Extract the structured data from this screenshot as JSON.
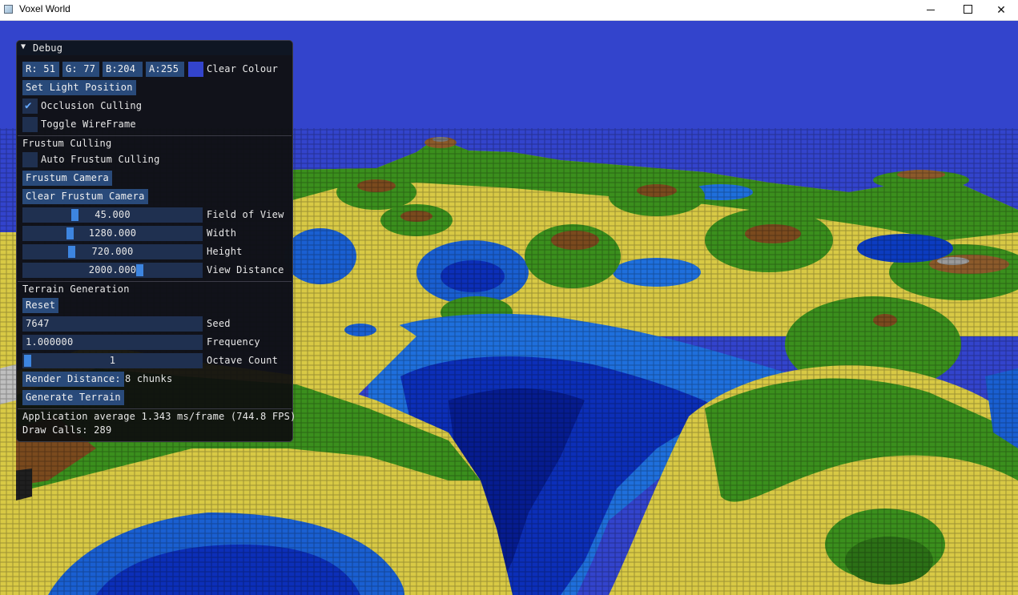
{
  "window": {
    "title": "Voxel World"
  },
  "colors": {
    "sky": "#3344cc",
    "button": "#294a7a",
    "frame": "#1f3050",
    "grab": "#3d85e0"
  },
  "debug": {
    "title": "Debug",
    "clear_colour": {
      "r": "R: 51",
      "g": "G: 77",
      "b": "B:204",
      "a": "A:255",
      "label": "Clear Colour"
    },
    "set_light_position": "Set Light Position",
    "occlusion_culling": {
      "label": "Occlusion Culling",
      "checked": true
    },
    "toggle_wireframe": {
      "label": "Toggle WireFrame",
      "checked": false
    },
    "frustum_section": "Frustum Culling",
    "auto_frustum_culling": {
      "label": "Auto Frustum Culling",
      "checked": false
    },
    "frustum_camera": "Frustum Camera",
    "clear_frustum_camera": "Clear Frustum Camera",
    "sliders": [
      {
        "value": "45.000",
        "label": "Field of View",
        "fraction": 0.28
      },
      {
        "value": "1280.000",
        "label": "Width",
        "fraction": 0.25
      },
      {
        "value": "720.000",
        "label": "Height",
        "fraction": 0.26
      },
      {
        "value": "2000.000",
        "label": "View Distance",
        "fraction": 0.66
      }
    ],
    "terrain_section": "Terrain Generation",
    "reset": "Reset",
    "seed": {
      "value": "7647",
      "label": "Seed"
    },
    "frequency": {
      "value": "1.000000",
      "label": "Frequency"
    },
    "octave_count": {
      "value": "1",
      "label": "Octave Count",
      "fraction": 0.0
    },
    "render_distance": {
      "button": "Render Distance:",
      "value": "8 chunks"
    },
    "generate_terrain": "Generate Terrain",
    "stats": {
      "frame_time": "Application average 1.343 ms/frame (744.8 FPS)",
      "draw_calls": "Draw Calls: 289"
    }
  }
}
